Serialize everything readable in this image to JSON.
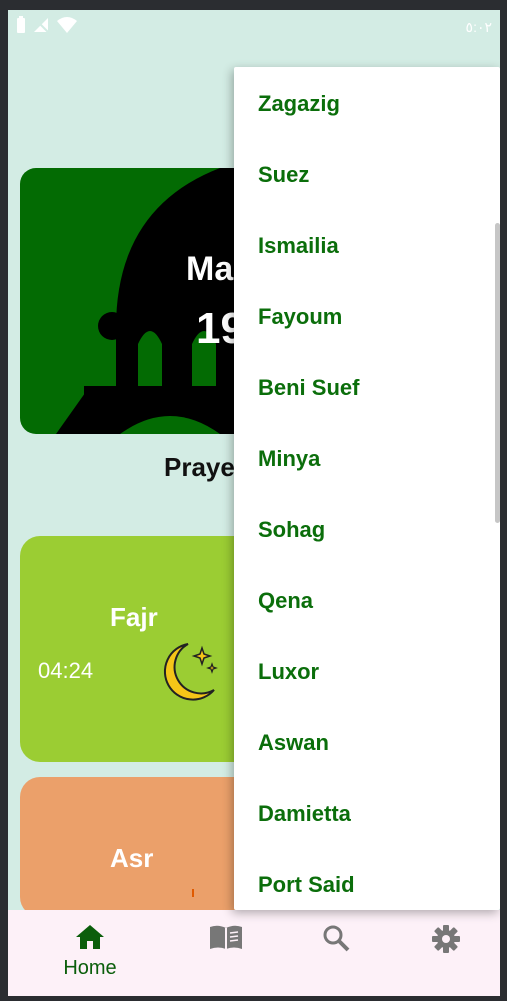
{
  "status_bar": {
    "time": "٥:٠٢"
  },
  "hero": {
    "title": "Ma",
    "number": "19"
  },
  "section_title": "Praye",
  "prayers": [
    {
      "name": "Fajr",
      "time": "04:24",
      "icon": "crescent-moon-icon"
    },
    {
      "name": "Asr",
      "time": "",
      "icon": "sun-icon"
    }
  ],
  "city_menu": {
    "items": [
      "Zagazig",
      "Suez",
      "Ismailia",
      "Fayoum",
      "Beni Suef",
      "Minya",
      "Sohag",
      "Qena",
      "Luxor",
      "Aswan",
      "Damietta",
      "Port Said"
    ]
  },
  "bottom_nav": {
    "items": [
      {
        "label": "Home",
        "icon": "home-icon"
      },
      {
        "label": "",
        "icon": "book-icon"
      },
      {
        "label": "",
        "icon": "search-icon"
      },
      {
        "label": "",
        "icon": "settings-icon"
      }
    ]
  },
  "colors": {
    "accent": "#036b03",
    "fajr_card": "#9bcd33",
    "asr_card": "#eba06a",
    "menu_text": "#0b6e0b"
  }
}
